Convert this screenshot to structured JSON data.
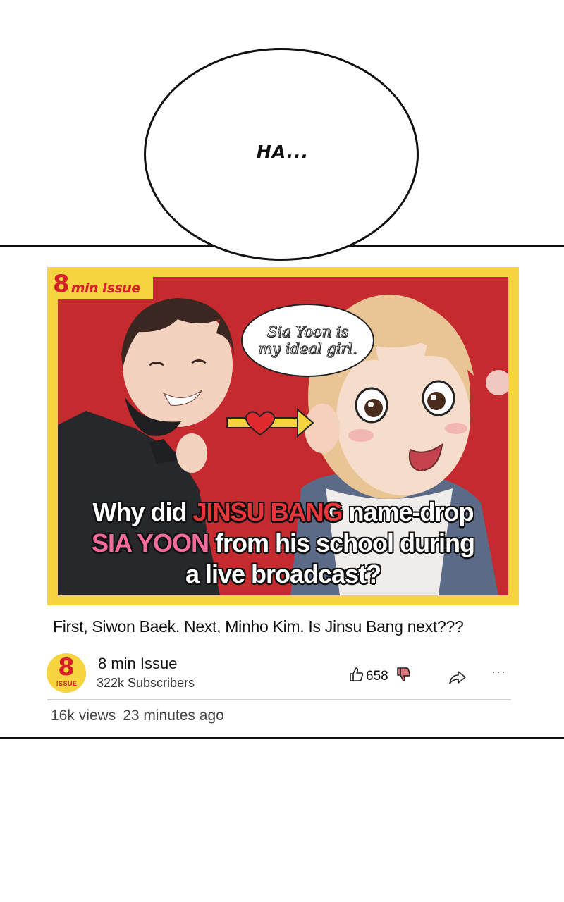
{
  "bubble": {
    "text": "HA..."
  },
  "thumbnail": {
    "brand_number": "8",
    "brand_text": "min Issue",
    "speech": "Sia Yoon is my ideal girl.",
    "headline": {
      "line1_pre": "Why did ",
      "line1_name": "JINSU BANG",
      "line1_post": " name-drop",
      "line2_name": "SIA YOON",
      "line2_post": " from his school during",
      "line3": "a live broadcast?"
    },
    "colors": {
      "frame": "#f5d440",
      "background": "#c42a2e",
      "accent_red": "#e8363b",
      "accent_pink": "#f36a9b"
    }
  },
  "video": {
    "title": "First, Siwon Baek. Next, Minho Kim. Is Jinsu Bang next???",
    "views": "16k views",
    "age": "23 minutes ago",
    "likes": "658"
  },
  "channel": {
    "avatar_number": "8",
    "avatar_label": "ISSUE",
    "name": "8 min Issue",
    "subscribers": "322k Subscribers"
  },
  "icons": {
    "like": "thumbs-up-icon",
    "dislike": "thumbs-down-icon",
    "share": "share-icon",
    "more": "more-icon"
  }
}
